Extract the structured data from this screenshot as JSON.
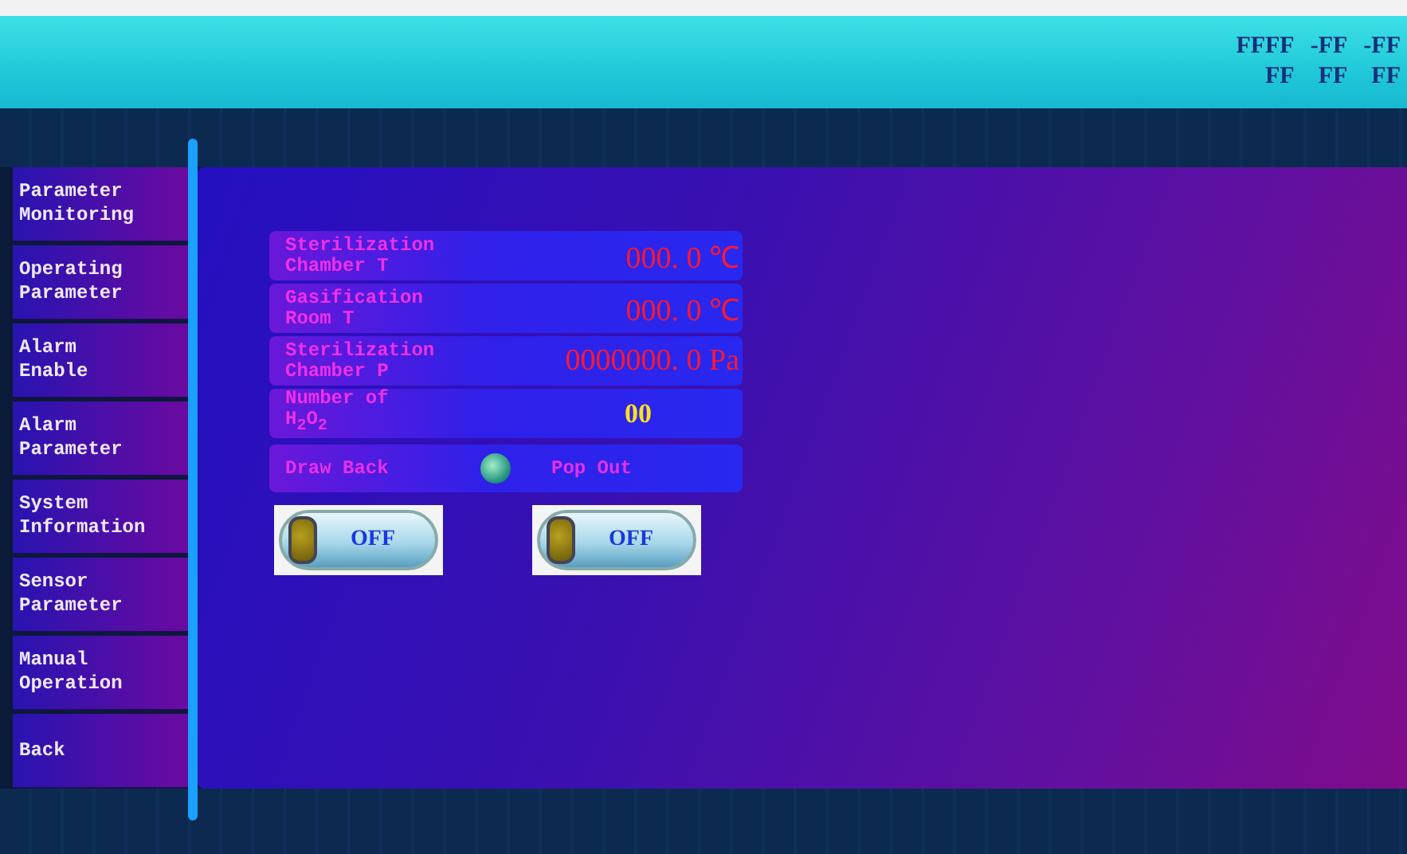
{
  "header": {
    "date_time": [
      "FFFF",
      "-FF",
      "-FF",
      "FF",
      "FF",
      "FF"
    ]
  },
  "sidebar": {
    "items": [
      "Parameter\nMonitoring",
      "Operating\nParameter",
      "Alarm\nEnable",
      "Alarm\nParameter",
      "System\nInformation",
      "Sensor\nParameter",
      "Manual\nOperation",
      "Back"
    ]
  },
  "readings": [
    {
      "label": "Sterilization\nChamber T",
      "value": "000. 0 ℃",
      "kind": "alarm"
    },
    {
      "label": "Gasification\nRoom T",
      "value": "000. 0 ℃",
      "kind": "alarm"
    },
    {
      "label": "Sterilization\nChamber P",
      "value": "0000000. 0 Pa",
      "kind": "alarm"
    },
    {
      "label": "Number of\nH$_{2}$O$_{2}$",
      "value": "00",
      "kind": "count"
    }
  ],
  "position": {
    "left": "Draw Back",
    "right": "Pop Out"
  },
  "switches": [
    {
      "label": "OFF",
      "on": false
    },
    {
      "label": "OFF",
      "on": false
    }
  ]
}
